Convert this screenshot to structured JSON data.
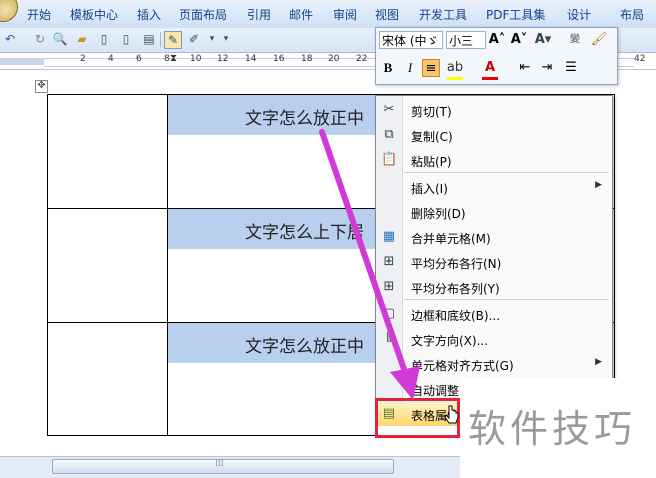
{
  "ribbon": {
    "tabs": [
      "开始",
      "模板中心",
      "插入",
      "页面布局",
      "引用",
      "邮件",
      "审阅",
      "视图",
      "开发工具",
      "PDF工具集",
      "设计",
      "布局"
    ]
  },
  "ruler": {
    "numbers": [
      "2",
      "4",
      "6",
      "8",
      "10",
      "12",
      "14",
      "16",
      "18",
      "20",
      "22",
      "42"
    ]
  },
  "table": {
    "cells": [
      "文字怎么放正中",
      "文字怎么上下居",
      "文字怎么放正中"
    ]
  },
  "mini_toolbar": {
    "font_name": "宋体 (中ゞ",
    "font_size": "小三"
  },
  "context_menu": {
    "items": [
      {
        "label": "剪切(T)",
        "icon": "scissors-icon"
      },
      {
        "label": "复制(C)",
        "icon": "copy-icon"
      },
      {
        "label": "粘贴(P)",
        "icon": "paste-icon"
      },
      {
        "label": "插入(I)",
        "icon": "",
        "submenu": true
      },
      {
        "label": "删除列(D)",
        "icon": ""
      },
      {
        "label": "合并单元格(M)",
        "icon": "merge-cells-icon"
      },
      {
        "label": "平均分布各行(N)",
        "icon": "distribute-rows-icon"
      },
      {
        "label": "平均分布各列(Y)",
        "icon": "distribute-columns-icon"
      },
      {
        "label": "边框和底纹(B)...",
        "icon": "borders-icon"
      },
      {
        "label": "文字方向(X)...",
        "icon": "text-direction-icon"
      },
      {
        "label": "单元格对齐方式(G)",
        "icon": "",
        "submenu": true
      },
      {
        "label": "自动调整",
        "icon": ""
      },
      {
        "label": "表格属性",
        "icon": "table-properties-icon"
      }
    ]
  },
  "watermark": {
    "text": "软件技巧"
  },
  "colors": {
    "cell_highlight": "#b8d0ee",
    "arrow": "#d23ad6",
    "highlight_box": "#e8203a"
  }
}
